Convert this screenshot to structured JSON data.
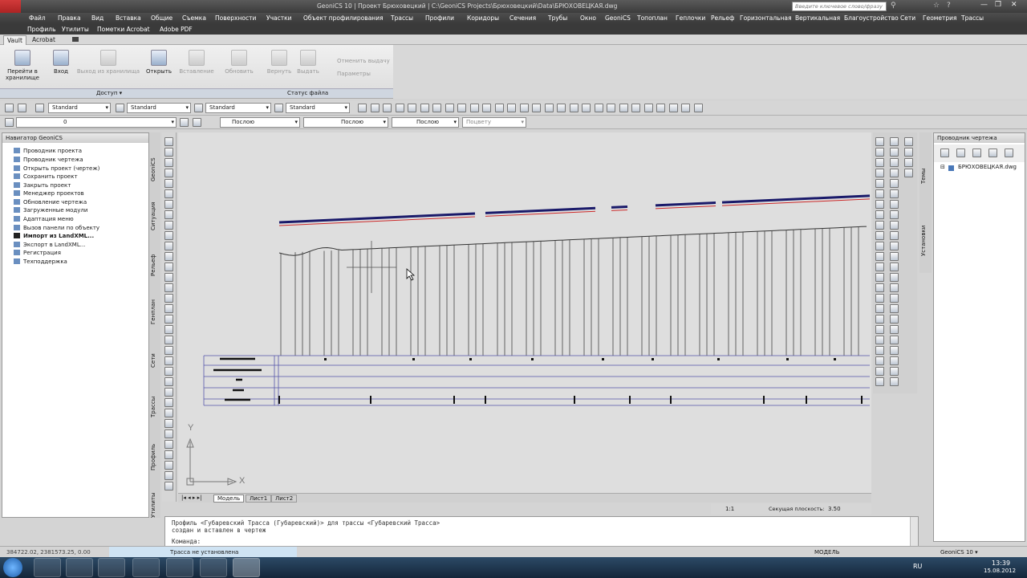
{
  "window": {
    "title": "GeoniCS 10 | Проект Брюховецкий | C:\\GeoniCS Projects\\Брюховецкий\\Data\\БРЮХОВЕЦКАЯ.dwg",
    "search_placeholder": "Введите ключевое слово/фразу"
  },
  "menu": [
    "Файл",
    "Правка",
    "Вид",
    "Вставка",
    "Общие",
    "Съемка",
    "Поверхности",
    "Участки",
    "Объект профилирования",
    "Трассы",
    "Профили",
    "Коридоры",
    "Сечения",
    "Трубы",
    "Окно",
    "GeoniCS",
    "Топоплан",
    "Геплочки",
    "Рельеф",
    "Горизонтальная",
    "Вертикальная",
    "Благоустройство",
    "Сети",
    "Геометрия",
    "Трассы"
  ],
  "menu2": [
    "Профиль",
    "Утилиты",
    "Пометки Acrobat",
    "Adobe PDF"
  ],
  "ribbon_tabs": [
    "Vault",
    "Acrobat"
  ],
  "ribbon": {
    "buttons": [
      {
        "label": "Перейти в\nхранилище",
        "enabled": true
      },
      {
        "label": "Вход",
        "enabled": true
      },
      {
        "label": "Выход из хранилища",
        "enabled": false
      },
      {
        "label": "Открыть",
        "enabled": true
      },
      {
        "label": "Вставление",
        "enabled": false
      },
      {
        "label": "Обновить",
        "enabled": false
      },
      {
        "label": "Вернуть",
        "enabled": false
      },
      {
        "label": "Выдать",
        "enabled": false
      }
    ],
    "small": [
      "Отменить выдачу",
      "Параметры"
    ],
    "groups": [
      "Доступ ▾",
      "Статус файла"
    ]
  },
  "toolbar1": {
    "styles": [
      "Standard",
      "Standard",
      "Standard",
      "Standard"
    ]
  },
  "toolbar2": {
    "layer": "0",
    "color": "Послою",
    "linetype": "Послою",
    "lineweight": "Послою",
    "plotstyle": "Поцвету"
  },
  "navigator": {
    "title": "Навигатор GeoniCS",
    "items": [
      "Проводник проекта",
      "Проводник чертежа",
      "Открыть проект (чертеж)",
      "Сохранить проект",
      "Закрыть проект",
      "Менеджер проектов",
      "Обновление чертежа",
      "Загруженные модули",
      "Адаптация меню",
      "Вызов панели по объекту",
      "Импорт из LandXML...",
      "Экспорт в LandXML...",
      "Регистрация",
      "Техподдержка"
    ]
  },
  "vtabs": [
    "GeoniCS",
    "Ситуация",
    "Рельеф",
    "Генплан",
    "Сети",
    "Трассы",
    "Профиль",
    "Утилиты"
  ],
  "sheet_tabs": [
    "Модель",
    "Лист1",
    "Лист2"
  ],
  "drawing_status": {
    "scale": "1:1",
    "section_label": "Секущая плоскость:",
    "section_value": "3.50"
  },
  "right_panel": {
    "title": "Проводник чертежа",
    "file": "БРЮХОВЕЦКАЯ.dwg",
    "vtabs": [
      "Темы",
      "Установки"
    ]
  },
  "command": {
    "lines": [
      "Профиль <Губаревский Трасса (Губаревский)> для трассы <Губаревский Трасса>",
      "создан и вставлен в чертеж"
    ],
    "prompt": "Команда:"
  },
  "status": {
    "coords": "384722.02, 2381573.25, 0.00",
    "message": "Трасса не установлена",
    "model": "МОДЕЛЬ",
    "workspace": "GeoniCS 10 ▾"
  },
  "taskbar": {
    "lang": "RU",
    "time": "13:39",
    "date": "15.08.2012"
  },
  "axes": {
    "y": "Y",
    "x": "X"
  }
}
